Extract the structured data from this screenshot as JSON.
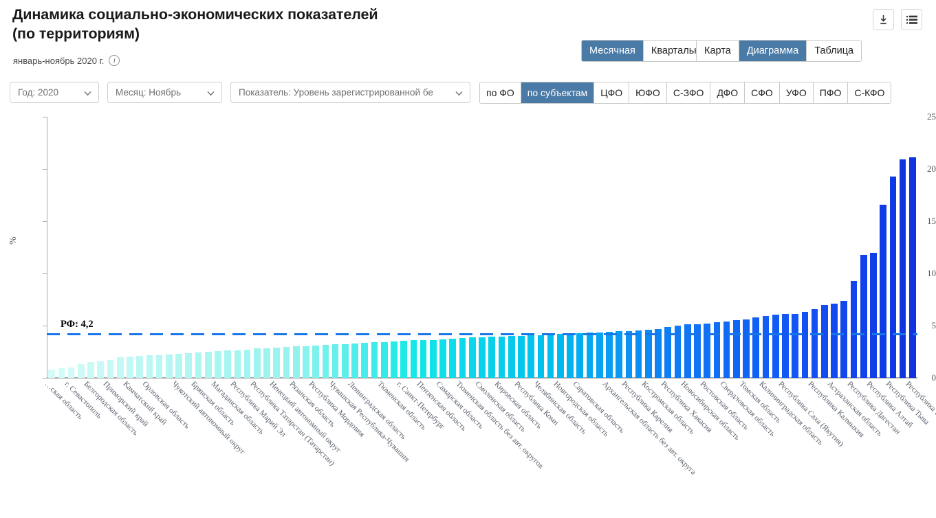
{
  "header": {
    "title_line1": "Динамика социально-экономических показателей",
    "title_line2": "(по территориям)",
    "subtitle": "январь-ноябрь 2020 г.",
    "info_glyph": "i",
    "download_icon": "download-icon",
    "list_icon": "list-icon"
  },
  "period_tabs": [
    {
      "label": "Месячная",
      "active": true
    },
    {
      "label": "Квартальная",
      "active": false
    }
  ],
  "view_tabs": [
    {
      "label": "Карта",
      "active": false
    },
    {
      "label": "Диаграмма",
      "active": true
    },
    {
      "label": "Таблица",
      "active": false
    }
  ],
  "region_tabs": [
    {
      "label": "по ФО",
      "active": false
    },
    {
      "label": "по субъектам",
      "active": true
    },
    {
      "label": "ЦФО",
      "active": false
    },
    {
      "label": "ЮФО",
      "active": false
    },
    {
      "label": "С-ЗФО",
      "active": false
    },
    {
      "label": "ДФО",
      "active": false
    },
    {
      "label": "СФО",
      "active": false
    },
    {
      "label": "УФО",
      "active": false
    },
    {
      "label": "ПФО",
      "active": false
    },
    {
      "label": "С-КФО",
      "active": false
    }
  ],
  "filters": [
    {
      "name": "year",
      "value": "Год: 2020"
    },
    {
      "name": "month",
      "value": "Месяц: Ноябрь"
    },
    {
      "name": "indicator",
      "value": "Показатель: Уровень зарегистрированной бе"
    }
  ],
  "colors": {
    "accent_tab": "#4a7ba7",
    "reference_line": "#1976e8",
    "bar_low": "#d4fbf8",
    "bar_mid": "#13e8e8",
    "bar_high": "#0d34e0",
    "axis": "#aaaaaa"
  },
  "chart_data": {
    "type": "bar",
    "title": "",
    "xlabel": "",
    "ylabel": "%",
    "ylim": [
      0,
      25
    ],
    "yticks": [
      0,
      5,
      10,
      15,
      20,
      25
    ],
    "grid": false,
    "legend": null,
    "reference_line": {
      "label": "РФ: 4,2",
      "value": 4.2
    },
    "first_label_truncated": true,
    "categories": [
      "…ская область",
      "г. Севастополь",
      "Белгородская область",
      "Приморский край",
      "Камчатский край",
      "Орловская область",
      "Чукотский автономный округ",
      "Брянская область",
      "Магаданская область",
      "Республика Марий Эл",
      "Республика Татарстан (Татарстан)",
      "Ненецкий автономный округ",
      "Рязанская область",
      "Республика Мордовия",
      "Чувашская Республика-Чувашия",
      "Ленинградская область",
      "Тюменская область",
      "г. Санкт-Петербург",
      "Пензенская область",
      "Самарская область",
      "Тюменская область без авт. округов",
      "Смоленская область",
      "Кировская область",
      "Республика Коми",
      "Челябинская область",
      "Новгородская область",
      "Саратовская область",
      "Архангельская область без авт. округа",
      "Республика Карелия",
      "Костромская область",
      "Республика Хакасия",
      "Новосибирская область",
      "Ростовская область",
      "Свердловская область",
      "Томская область",
      "Калининградская область",
      "Республика Саха (Якутия)",
      "Республика Калмыкия",
      "Астраханская область",
      "Республика Дагестан",
      "Республика Алтай",
      "Республика Тыва",
      "Республика Ингушетия"
    ],
    "values_note": "85 bars sorted ascending; labelled categories are a sampled subset of the axis ticks",
    "values": [
      0.8,
      0.95,
      1.0,
      1.3,
      1.5,
      1.6,
      1.7,
      2.0,
      2.05,
      2.1,
      2.15,
      2.2,
      2.25,
      2.3,
      2.4,
      2.45,
      2.5,
      2.55,
      2.6,
      2.65,
      2.7,
      2.8,
      2.85,
      2.9,
      2.95,
      3.0,
      3.05,
      3.1,
      3.15,
      3.2,
      3.25,
      3.3,
      3.35,
      3.4,
      3.45,
      3.5,
      3.55,
      3.6,
      3.6,
      3.65,
      3.7,
      3.75,
      3.8,
      3.85,
      3.9,
      3.95,
      3.95,
      4.0,
      4.0,
      4.05,
      4.1,
      4.15,
      4.2,
      4.25,
      4.3,
      4.35,
      4.35,
      4.4,
      4.45,
      4.5,
      4.55,
      4.6,
      4.7,
      4.9,
      5.0,
      5.1,
      5.15,
      5.2,
      5.3,
      5.4,
      5.5,
      5.6,
      5.8,
      5.95,
      6.05,
      6.1,
      6.15,
      6.3,
      6.6,
      6.95,
      7.1,
      7.4,
      9.3,
      11.8,
      11.95,
      16.6,
      19.3,
      20.9,
      21.1
    ]
  }
}
